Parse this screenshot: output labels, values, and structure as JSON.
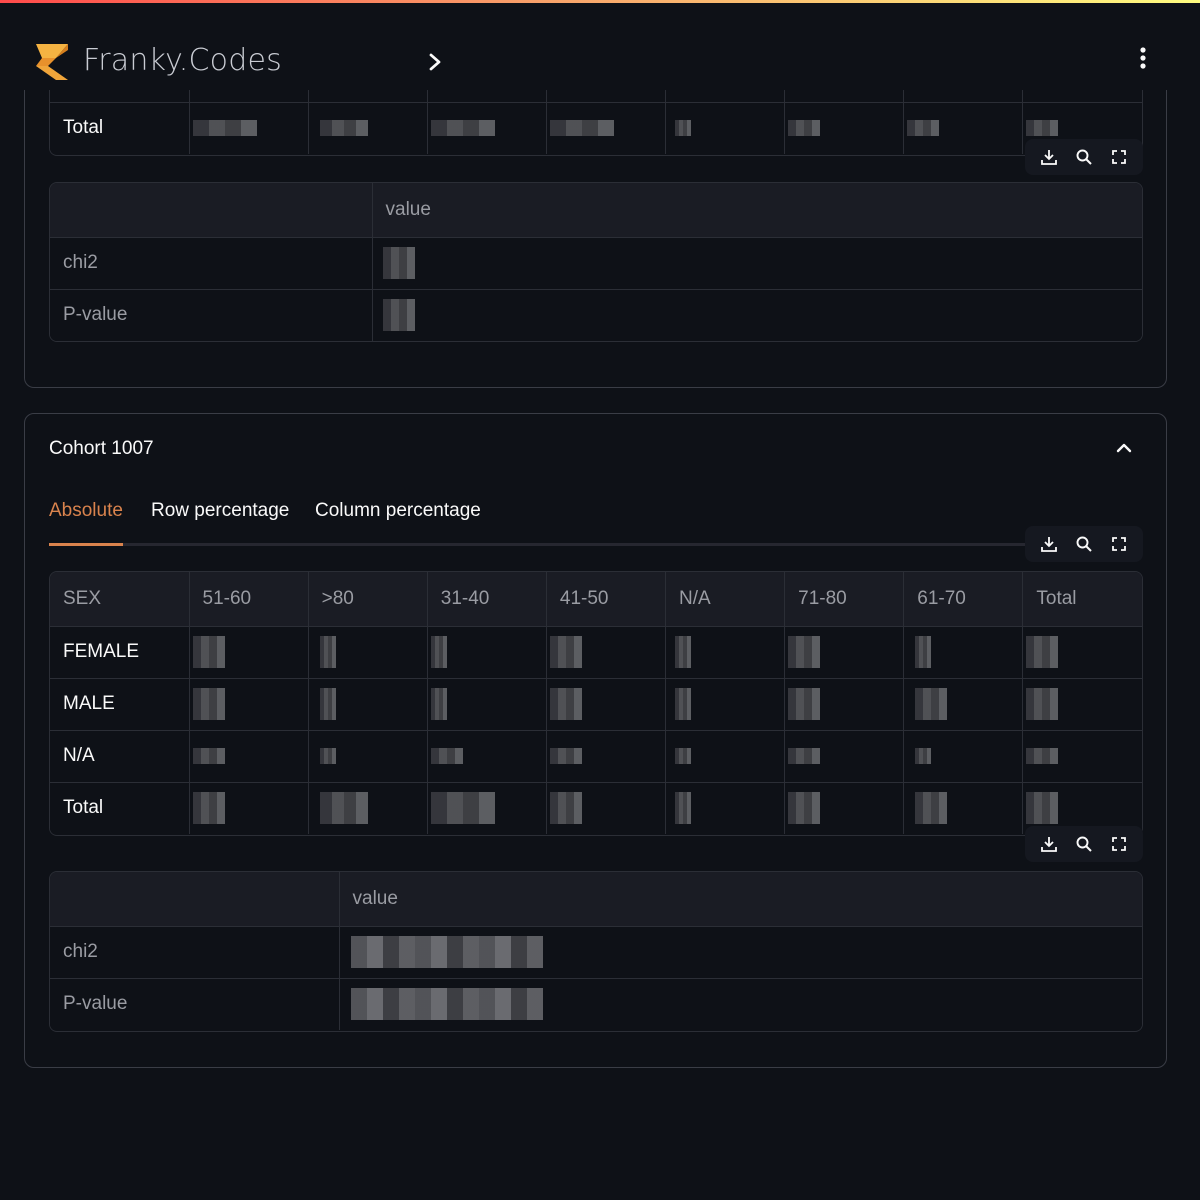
{
  "app": {
    "brand": "Franky.Codes",
    "accent_color": "#d9834d",
    "gradient_colors": [
      "#ff4b4b",
      "#f8a16a",
      "#fffd80"
    ],
    "logo_icon": "lightning-logo-icon",
    "expand_sidebar_icon": "chevron-right-icon",
    "main_menu_icon": "vertical-dots-icon"
  },
  "previous_cohort": {
    "contingency_table": {
      "visible_rows": [
        {
          "label": "Total",
          "cells": [
            "redacted",
            "redacted",
            "redacted",
            "redacted",
            "redacted",
            "redacted",
            "redacted",
            "redacted"
          ]
        }
      ]
    },
    "stats_table": {
      "header": [
        "",
        "value"
      ],
      "rows": [
        {
          "label": "chi2",
          "value": "redacted"
        },
        {
          "label": "P-value",
          "value": "redacted"
        }
      ]
    }
  },
  "cohort": {
    "title": "Cohort 1007",
    "collapse_icon": "chevron-up-icon",
    "tabs": [
      {
        "label": "Absolute",
        "active": true
      },
      {
        "label": "Row percentage",
        "active": false
      },
      {
        "label": "Column percentage",
        "active": false
      }
    ],
    "toolbar": {
      "download": "download-icon",
      "search": "search-icon",
      "fullscreen": "fullscreen-icon"
    },
    "contingency_table": {
      "columns": [
        "SEX",
        "51-60",
        ">80",
        "31-40",
        "41-50",
        "N/A",
        "71-80",
        "61-70",
        "Total"
      ],
      "rows": [
        {
          "label": "FEMALE",
          "cells": [
            "redacted",
            "redacted",
            "redacted",
            "redacted",
            "redacted",
            "redacted",
            "redacted",
            "redacted"
          ]
        },
        {
          "label": "MALE",
          "cells": [
            "redacted",
            "redacted",
            "redacted",
            "redacted",
            "redacted",
            "redacted",
            "redacted",
            "redacted"
          ]
        },
        {
          "label": "N/A",
          "cells": [
            "redacted",
            "redacted",
            "redacted",
            "redacted",
            "redacted",
            "redacted",
            "redacted",
            "redacted"
          ]
        },
        {
          "label": "Total",
          "cells": [
            "redacted",
            "redacted",
            "redacted",
            "redacted",
            "redacted",
            "redacted",
            "redacted",
            "redacted"
          ]
        }
      ]
    },
    "stats_table": {
      "header": [
        "",
        "value"
      ],
      "rows": [
        {
          "label": "chi2",
          "value": "redacted"
        },
        {
          "label": "P-value",
          "value": "redacted"
        }
      ]
    }
  }
}
